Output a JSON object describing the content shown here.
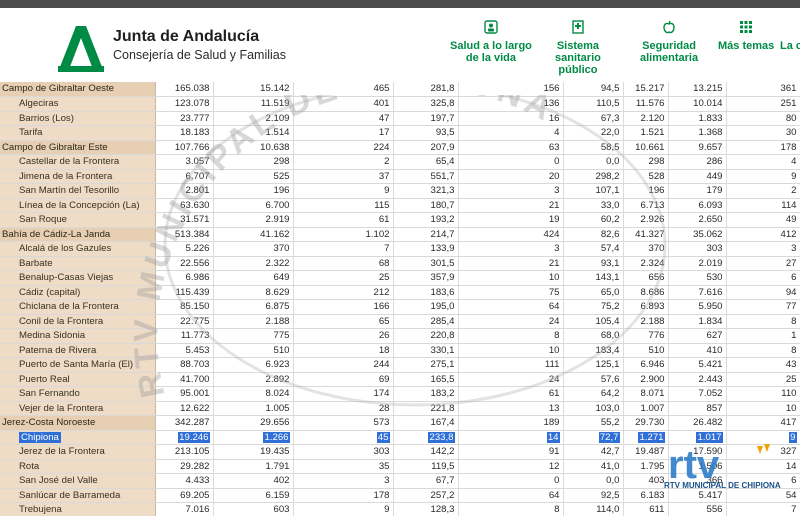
{
  "header": {
    "brand_title": "Junta de Andalucía",
    "brand_subtitle": "Consejería de Salud y Familias",
    "nav": [
      {
        "label_lines": [
          "Salud a lo largo",
          "de la vida"
        ],
        "icon": "person-icon"
      },
      {
        "label_lines": [
          "Sistema",
          "sanitario",
          "público"
        ],
        "icon": "hospital-icon"
      },
      {
        "label_lines": [
          "Seguridad",
          "alimentaria"
        ],
        "icon": "apple-icon"
      },
      {
        "label_lines": [
          "Más temas"
        ],
        "icon": "grid-icon"
      },
      {
        "label_lines": [
          "La c"
        ],
        "icon": ""
      }
    ]
  },
  "colors": {
    "brand_green": "#008b45",
    "name_column": "#eedcc7",
    "selection": "#2f6fd6"
  },
  "table": {
    "rows": [
      {
        "name": "Campo de Gibraltar Oeste",
        "type": "region",
        "values": [
          "165.038",
          "15.142",
          "465",
          "281,8",
          "156",
          "94,5",
          "15.217",
          "13.215",
          "361"
        ]
      },
      {
        "name": "Algeciras",
        "type": "muni",
        "values": [
          "123.078",
          "11.519",
          "401",
          "325,8",
          "136",
          "110,5",
          "11.576",
          "10.014",
          "251"
        ]
      },
      {
        "name": "Barrios (Los)",
        "type": "muni",
        "values": [
          "23.777",
          "2.109",
          "47",
          "197,7",
          "16",
          "67,3",
          "2.120",
          "1.833",
          "80"
        ]
      },
      {
        "name": "Tarifa",
        "type": "muni",
        "values": [
          "18.183",
          "1.514",
          "17",
          "93,5",
          "4",
          "22,0",
          "1.521",
          "1.368",
          "30"
        ]
      },
      {
        "name": "Campo de Gibraltar Este",
        "type": "region",
        "values": [
          "107.766",
          "10.638",
          "224",
          "207,9",
          "63",
          "58,5",
          "10.661",
          "9.657",
          "178"
        ]
      },
      {
        "name": "Castellar de la Frontera",
        "type": "muni",
        "values": [
          "3.057",
          "298",
          "2",
          "65,4",
          "0",
          "0,0",
          "298",
          "286",
          "4"
        ]
      },
      {
        "name": "Jimena de la Frontera",
        "type": "muni",
        "values": [
          "6.707",
          "525",
          "37",
          "551,7",
          "20",
          "298,2",
          "528",
          "449",
          "9"
        ]
      },
      {
        "name": "San Martín del Tesorillo",
        "type": "muni",
        "values": [
          "2.801",
          "196",
          "9",
          "321,3",
          "3",
          "107,1",
          "196",
          "179",
          "2"
        ]
      },
      {
        "name": "Línea de la Concepción (La)",
        "type": "muni",
        "values": [
          "63.630",
          "6.700",
          "115",
          "180,7",
          "21",
          "33,0",
          "6.713",
          "6.093",
          "114"
        ]
      },
      {
        "name": "San Roque",
        "type": "muni",
        "values": [
          "31.571",
          "2.919",
          "61",
          "193,2",
          "19",
          "60,2",
          "2.926",
          "2.650",
          "49"
        ]
      },
      {
        "name": "Bahía de Cádiz-La Janda",
        "type": "region",
        "values": [
          "513.384",
          "41.162",
          "1.102",
          "214,7",
          "424",
          "82,6",
          "41.327",
          "35.062",
          "412"
        ]
      },
      {
        "name": "Alcalá de los Gazules",
        "type": "muni",
        "values": [
          "5.226",
          "370",
          "7",
          "133,9",
          "3",
          "57,4",
          "370",
          "303",
          "3"
        ]
      },
      {
        "name": "Barbate",
        "type": "muni",
        "values": [
          "22.556",
          "2.322",
          "68",
          "301,5",
          "21",
          "93,1",
          "2.324",
          "2.019",
          "27"
        ]
      },
      {
        "name": "Benalup-Casas Viejas",
        "type": "muni",
        "values": [
          "6.986",
          "649",
          "25",
          "357,9",
          "10",
          "143,1",
          "656",
          "530",
          "6"
        ]
      },
      {
        "name": "Cádiz (capital)",
        "type": "muni",
        "values": [
          "115.439",
          "8.629",
          "212",
          "183,6",
          "75",
          "65,0",
          "8.686",
          "7.616",
          "94"
        ]
      },
      {
        "name": "Chiclana de la Frontera",
        "type": "muni",
        "values": [
          "85.150",
          "6.875",
          "166",
          "195,0",
          "64",
          "75,2",
          "6.893",
          "5.950",
          "77"
        ]
      },
      {
        "name": "Conil de la Frontera",
        "type": "muni",
        "values": [
          "22.775",
          "2.188",
          "65",
          "285,4",
          "24",
          "105,4",
          "2.188",
          "1.834",
          "8"
        ]
      },
      {
        "name": "Medina Sidonia",
        "type": "muni",
        "values": [
          "11.773",
          "775",
          "26",
          "220,8",
          "8",
          "68,0",
          "776",
          "627",
          "1"
        ]
      },
      {
        "name": "Paterna de Rivera",
        "type": "muni",
        "values": [
          "5.453",
          "510",
          "18",
          "330,1",
          "10",
          "183,4",
          "510",
          "410",
          "8"
        ]
      },
      {
        "name": "Puerto de Santa María (El)",
        "type": "muni",
        "values": [
          "88.703",
          "6.923",
          "244",
          "275,1",
          "111",
          "125,1",
          "6.946",
          "5.421",
          "43"
        ]
      },
      {
        "name": "Puerto Real",
        "type": "muni",
        "values": [
          "41.700",
          "2.892",
          "69",
          "165,5",
          "24",
          "57,6",
          "2.900",
          "2.443",
          "25"
        ]
      },
      {
        "name": "San Fernando",
        "type": "muni",
        "values": [
          "95.001",
          "8.024",
          "174",
          "183,2",
          "61",
          "64,2",
          "8.071",
          "7.052",
          "110"
        ]
      },
      {
        "name": "Vejer de la Frontera",
        "type": "muni",
        "values": [
          "12.622",
          "1.005",
          "28",
          "221,8",
          "13",
          "103,0",
          "1.007",
          "857",
          "10"
        ]
      },
      {
        "name": "Jerez-Costa Noroeste",
        "type": "region",
        "values": [
          "342.287",
          "29.656",
          "573",
          "167,4",
          "189",
          "55,2",
          "29.730",
          "26.482",
          "417"
        ]
      },
      {
        "name": "Chipiona",
        "type": "muni",
        "selected": true,
        "values": [
          "19.246",
          "1.266",
          "45",
          "233,8",
          "14",
          "72,7",
          "1.271",
          "1.017",
          "9"
        ]
      },
      {
        "name": "Jerez de la Frontera",
        "type": "muni",
        "values": [
          "213.105",
          "19.435",
          "303",
          "142,2",
          "91",
          "42,7",
          "19.487",
          "17.590",
          "327"
        ]
      },
      {
        "name": "Rota",
        "type": "muni",
        "values": [
          "29.282",
          "1.791",
          "35",
          "119,5",
          "12",
          "41,0",
          "1.795",
          "1.506",
          "14"
        ]
      },
      {
        "name": "San José del Valle",
        "type": "muni",
        "values": [
          "4.433",
          "402",
          "3",
          "67,7",
          "0",
          "0,0",
          "403",
          "366",
          "6"
        ]
      },
      {
        "name": "Sanlúcar de Barrameda",
        "type": "muni",
        "values": [
          "69.205",
          "6.159",
          "178",
          "257,2",
          "64",
          "92,5",
          "6.183",
          "5.417",
          "54"
        ]
      },
      {
        "name": "Trebujena",
        "type": "muni",
        "values": [
          "7.016",
          "603",
          "9",
          "128,3",
          "8",
          "114,0",
          "611",
          "556",
          "7"
        ]
      }
    ]
  },
  "watermark": {
    "ring_text": "RTV MUNICIPAL DE CHIPIONA",
    "logo_letters": "rtv",
    "logo_caption": "RTV MUNICIPAL DE CHIPIONA"
  }
}
